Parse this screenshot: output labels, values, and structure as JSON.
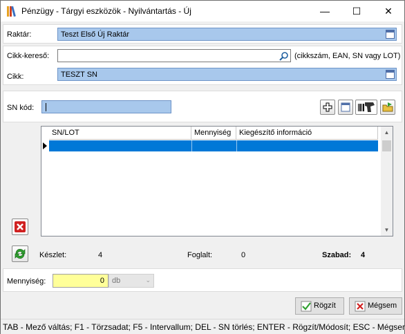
{
  "window": {
    "title": "Pénzügy - Tárgyi eszközök - Nyilvántartás - Új",
    "minimize": "—",
    "maximize": "☐",
    "close": "✕"
  },
  "form": {
    "raktar_label": "Raktár:",
    "raktar_value": "Teszt Első Új Raktár",
    "cikk_kereso_label": "Cikk-kereső:",
    "cikk_kereso_value": "",
    "cikk_kereso_hint": "(cikkszám, EAN, SN vagy LOT)",
    "cikk_label": "Cikk:",
    "cikk_value": "TESZT SN",
    "sn_kod_label": "SN kód:",
    "sn_kod_value": ""
  },
  "grid": {
    "columns": [
      "SN/LOT",
      "Mennyiség",
      "Kiegészítő információ"
    ],
    "rows": [
      [
        "",
        "",
        ""
      ]
    ]
  },
  "stock": {
    "keszlet_label": "Készlet:",
    "keszlet_value": "4",
    "foglalt_label": "Foglalt:",
    "foglalt_value": "0",
    "szabad_label": "Szabad:",
    "szabad_value": "4"
  },
  "quantity": {
    "label": "Mennyiség:",
    "value": "0",
    "unit": "db"
  },
  "buttons": {
    "save": "Rögzít",
    "cancel": "Mégsem"
  },
  "status_bar": "TAB - Mező váltás; F1 - Törzsadat; F5 - Intervallum; DEL - SN törlés; ENTER - Rögzít/Módosít; ESC - Mégsem",
  "colors": {
    "selection": "#0078d7",
    "field_blue": "#a8c8ec",
    "quantity_yellow": "#ffff99"
  }
}
